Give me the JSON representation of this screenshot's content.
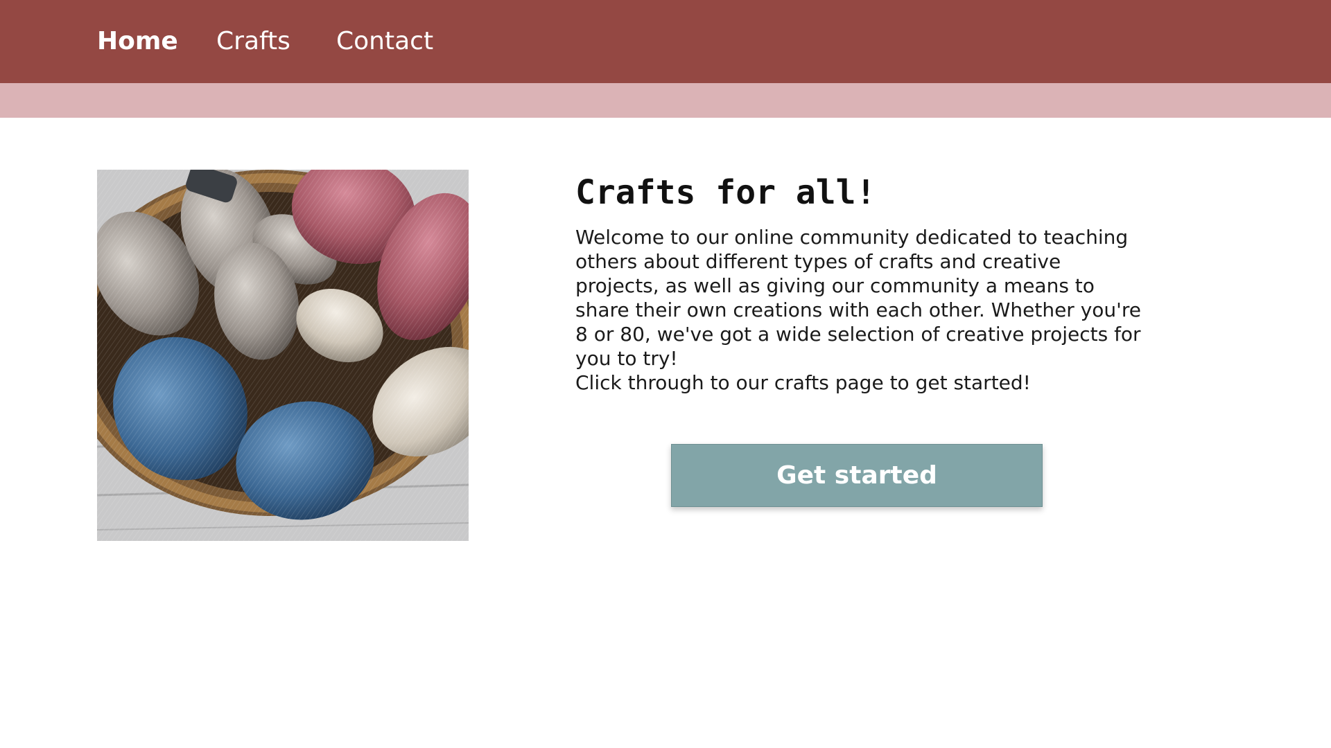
{
  "nav": {
    "home": "Home",
    "crafts": "Crafts",
    "contact": "Contact"
  },
  "hero": {
    "image_subject": "yarn-basket-image",
    "title": "Crafts for all!",
    "paragraph1": "Welcome to our online community dedicated to teaching others about different types of crafts and creative projects, as well as giving our community a means to share their own creations with each other. Whether you're 8 or 80, we've got a wide selection of creative projects for you to try!",
    "paragraph2": "Click through to our crafts page to get started!",
    "cta_label": "Get started"
  },
  "colors": {
    "nav_background": "#944843",
    "subbar_background": "#dbb3b6",
    "button_background": "#82a5a8",
    "page_background": "#ffffff"
  }
}
